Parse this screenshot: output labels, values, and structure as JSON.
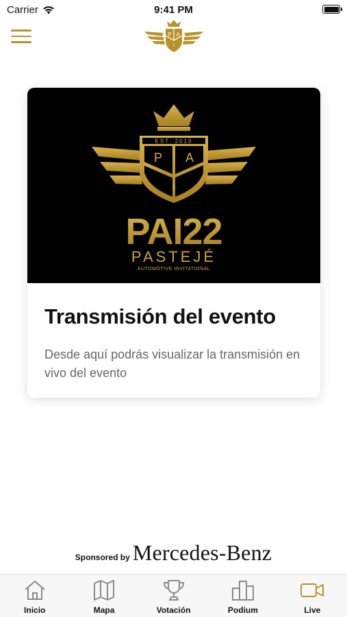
{
  "status_bar": {
    "carrier": "Carrier",
    "time": "9:41 PM",
    "battery_level": 1.0
  },
  "header": {
    "logo_letters": [
      "P",
      "A",
      "I"
    ],
    "menu_icon": "hamburger-icon"
  },
  "card": {
    "logo": {
      "established": "EST. 2019",
      "letters": [
        "P",
        "A",
        "I"
      ],
      "wordmark": "PAI22",
      "name": "PASTEJÉ",
      "tagline": "AUTOMOTIVE INVITATIONAL"
    },
    "title": "Transmisión del evento",
    "description": "Desde aquí podrás visualizar la transmisión en vivo del evento"
  },
  "sponsor": {
    "label": "Sponsored by",
    "brand": "Mercedes-Benz"
  },
  "tabs": [
    {
      "label": "Inicio",
      "icon": "home-icon",
      "active": false
    },
    {
      "label": "Mapa",
      "icon": "map-icon",
      "active": false
    },
    {
      "label": "Votación",
      "icon": "trophy-icon",
      "active": false
    },
    {
      "label": "Podium",
      "icon": "podium-icon",
      "active": false
    },
    {
      "label": "Live",
      "icon": "video-camera-icon",
      "active": true
    }
  ],
  "colors": {
    "gold": "#b8922a",
    "gold_light": "#d4b04a",
    "tab_icon_inactive": "#8a8a8a",
    "background": "#ffffff"
  }
}
